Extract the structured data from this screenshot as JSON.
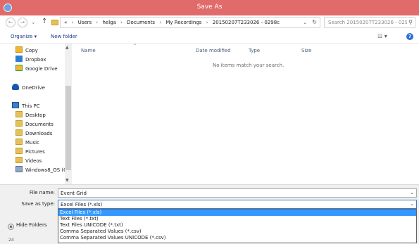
{
  "window": {
    "title": "Save As"
  },
  "address": {
    "back_icon": "arrow-left",
    "forward_icon": "arrow-right",
    "recent_icon": "chevron-down",
    "up_icon": "arrow-up",
    "overflow": "«",
    "crumbs": [
      "Users",
      "helga",
      "Documents",
      "My Recordings",
      "20150207T233026 - 0298c"
    ],
    "dropdown_glyph": "⌄",
    "refresh_glyph": "↻"
  },
  "search": {
    "placeholder": "Search 20150207T233026 - 029..."
  },
  "toolbar": {
    "organize_label": "Organize ▾",
    "new_folder_label": "New folder",
    "view_glyph": "☷ ▾",
    "help_glyph": "?"
  },
  "nav": {
    "items": [
      {
        "label": "Copy",
        "icon": "copy-icon"
      },
      {
        "label": "Dropbox",
        "icon": "dropbox-icon"
      },
      {
        "label": "Google Drive",
        "icon": "google-drive-icon"
      },
      {
        "label": "OneDrive",
        "icon": "onedrive-icon"
      },
      {
        "label": "This PC",
        "icon": "computer-icon"
      },
      {
        "label": "Desktop",
        "icon": "folder-icon"
      },
      {
        "label": "Documents",
        "icon": "folder-icon"
      },
      {
        "label": "Downloads",
        "icon": "folder-icon"
      },
      {
        "label": "Music",
        "icon": "folder-icon"
      },
      {
        "label": "Pictures",
        "icon": "folder-icon"
      },
      {
        "label": "Videos",
        "icon": "folder-icon"
      },
      {
        "label": "Windows8_OS (C",
        "icon": "drive-icon"
      }
    ]
  },
  "columns": {
    "name": "Name",
    "date": "Date modified",
    "type": "Type",
    "size": "Size"
  },
  "content": {
    "empty_message": "No items match your search."
  },
  "form": {
    "file_name_label": "File name:",
    "file_name_value": "Event Grid",
    "save_type_label": "Save as type:",
    "save_type_value": "Excel Files (*.xls)",
    "options": [
      "Excel Files (*.xls)",
      "Text Files (*.txt)",
      "Text Files UNICODE (*.txt)",
      "Comma Separated Values (*.csv)",
      "Comma Separated Values UNICODE (*.csv)"
    ],
    "selected_index": 0
  },
  "hide_folders": {
    "label": "Hide Folders"
  },
  "taskbar": {
    "number": "24"
  },
  "colors": {
    "titlebar": "#e16b6b",
    "selection": "#3399ff",
    "link": "#1e3a8a"
  }
}
